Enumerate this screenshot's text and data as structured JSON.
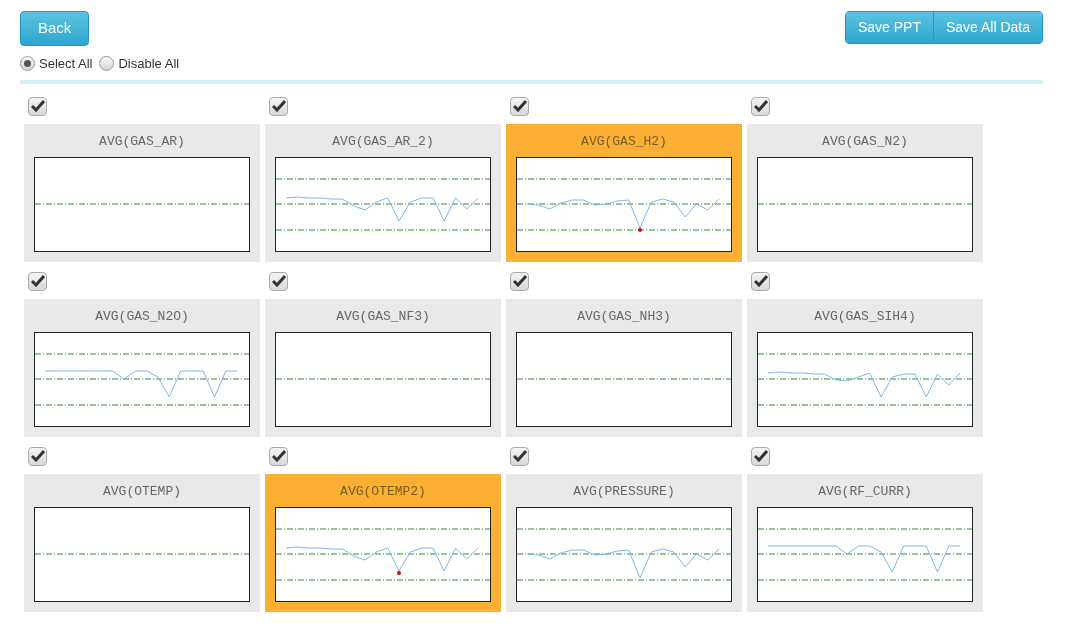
{
  "toolbar": {
    "back": "Back",
    "actions": [
      "Save PPT",
      "Save All Data"
    ]
  },
  "selection": [
    {
      "label": "Select All",
      "selected": true
    },
    {
      "label": "Disable All",
      "selected": false
    }
  ],
  "cards": [
    {
      "title": "AVG(GAS_AR)",
      "checked": true,
      "alarm": false,
      "kind": "flat"
    },
    {
      "title": "AVG(GAS_AR_2)",
      "checked": true,
      "alarm": false,
      "kind": "trend"
    },
    {
      "title": "AVG(GAS_H2)",
      "checked": true,
      "alarm": true,
      "kind": "trend"
    },
    {
      "title": "AVG(GAS_N2)",
      "checked": true,
      "alarm": false,
      "kind": "flat"
    },
    {
      "title": "AVG(GAS_N2O)",
      "checked": true,
      "alarm": false,
      "kind": "trend"
    },
    {
      "title": "AVG(GAS_NF3)",
      "checked": true,
      "alarm": false,
      "kind": "flat"
    },
    {
      "title": "AVG(GAS_NH3)",
      "checked": true,
      "alarm": false,
      "kind": "flat"
    },
    {
      "title": "AVG(GAS_SIH4)",
      "checked": true,
      "alarm": false,
      "kind": "trend"
    },
    {
      "title": "AVG(OTEMP)",
      "checked": true,
      "alarm": false,
      "kind": "flat"
    },
    {
      "title": "AVG(OTEMP2)",
      "checked": true,
      "alarm": true,
      "kind": "trend"
    },
    {
      "title": "AVG(PRESSURE)",
      "checked": true,
      "alarm": false,
      "kind": "trend"
    },
    {
      "title": "AVG(RF_CURR)",
      "checked": true,
      "alarm": false,
      "kind": "trend"
    }
  ]
}
